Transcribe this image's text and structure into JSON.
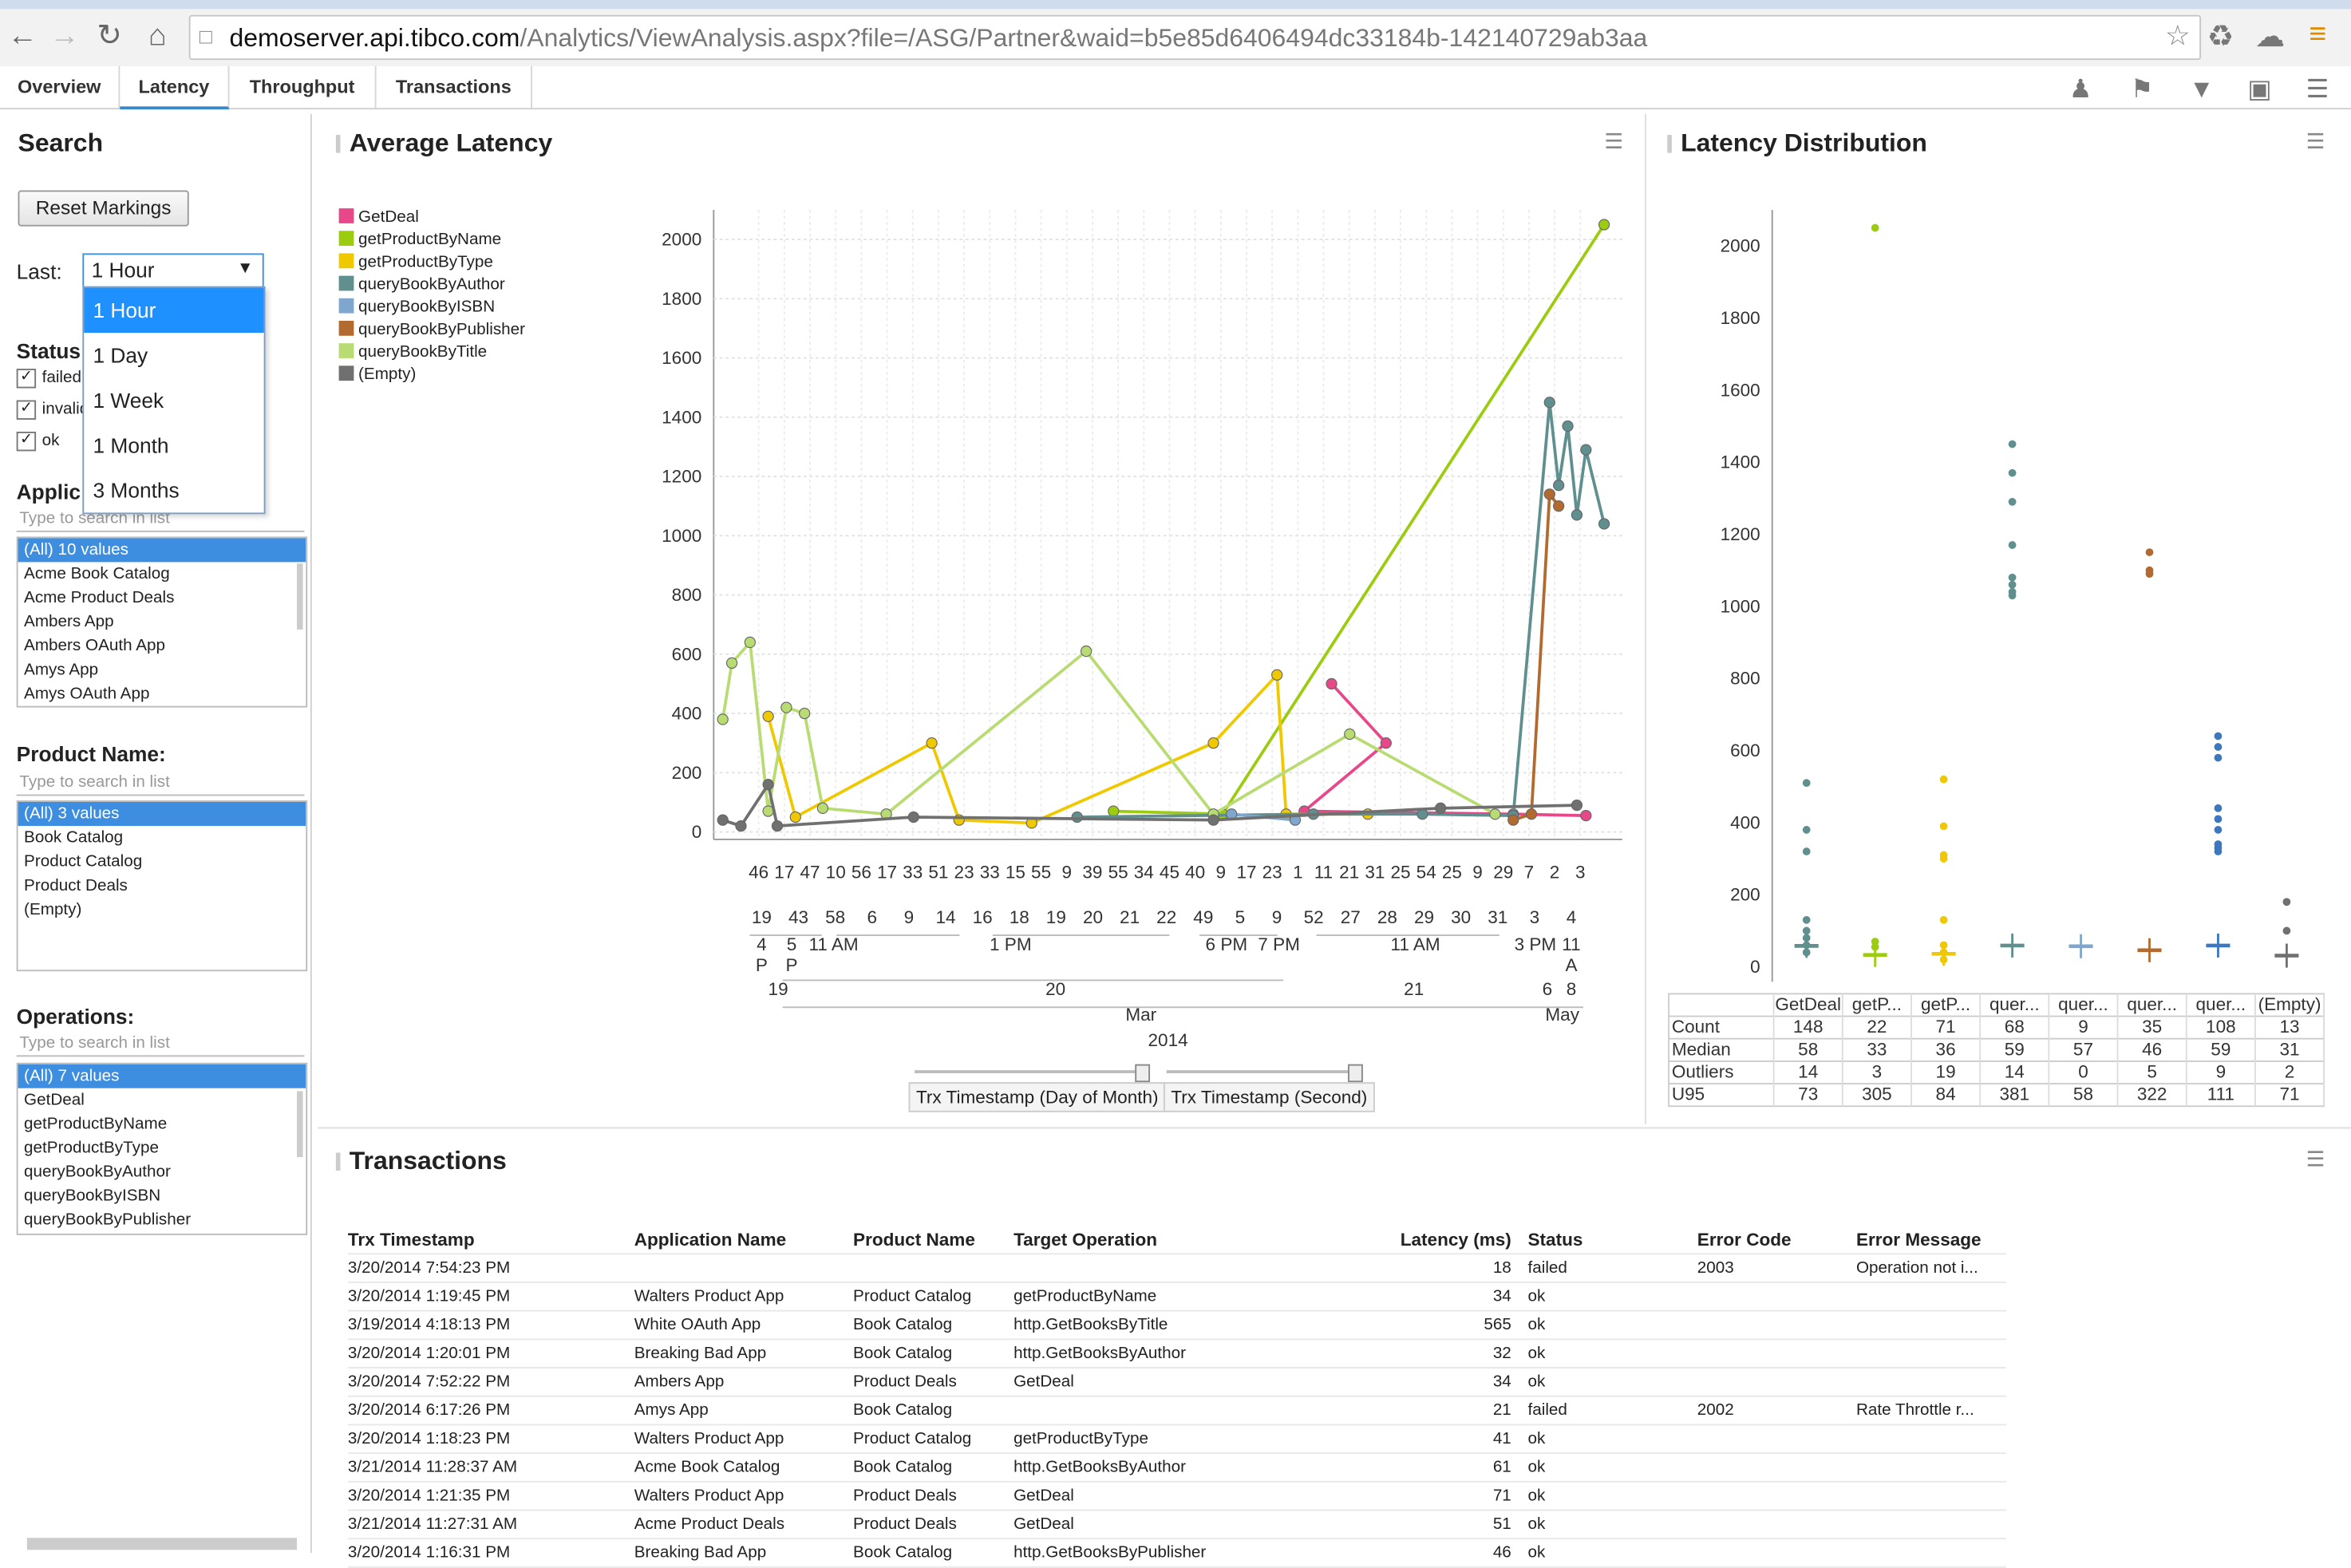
{
  "browser": {
    "url_domain": "demoserver.api.tibco.com",
    "url_path": "/Analytics/ViewAnalysis.aspx?file=/ASG/Partner&waid=b5e85d6406494dc33184b-142140729ab3aa"
  },
  "tabs": [
    {
      "label": "Overview",
      "active": false
    },
    {
      "label": "Latency",
      "active": true
    },
    {
      "label": "Throughput",
      "active": false
    },
    {
      "label": "Transactions",
      "active": false
    }
  ],
  "search": {
    "title": "Search",
    "reset_label": "Reset Markings",
    "last_label": "Last:",
    "last_value": "1 Hour",
    "last_options": [
      "1 Hour",
      "1 Day",
      "1 Week",
      "1 Month",
      "3 Months"
    ],
    "status_label": "Status:",
    "status_items": [
      {
        "label": "failed",
        "checked": true
      },
      {
        "label": "invalid",
        "checked": true
      },
      {
        "label": "ok",
        "checked": true
      }
    ],
    "application_label": "Applic",
    "application_placeholder": "Type to search in list",
    "application_items": [
      "(All) 10 values",
      "Acme Book Catalog",
      "Acme Product Deals",
      "Ambers App",
      "Ambers OAuth App",
      "Amys App",
      "Amys OAuth App"
    ],
    "product_label": "Product Name:",
    "product_placeholder": "Type to search in list",
    "product_items": [
      "(All) 3 values",
      "Book Catalog",
      "Product Catalog",
      "Product Deals",
      "(Empty)"
    ],
    "operations_label": "Operations:",
    "operations_placeholder": "Type to search in list",
    "operations_items": [
      "(All) 7 values",
      "GetDeal",
      "getProductByName",
      "getProductByType",
      "queryBookByAuthor",
      "queryBookByISBN",
      "queryBookByPublisher"
    ]
  },
  "avg_latency": {
    "title": "Average Latency",
    "x_levels": {
      "level1": [
        "46",
        "17",
        "47",
        "10",
        "56",
        "17",
        "33",
        "51",
        "23",
        "33",
        "15",
        "55",
        "9",
        "39",
        "55",
        "34",
        "45",
        "40",
        "9",
        "17",
        "23",
        "1",
        "11",
        "21",
        "31",
        "25",
        "54",
        "25",
        "9",
        "29",
        "7",
        "2",
        "3"
      ],
      "level2": [
        "19",
        "43",
        "58",
        "6",
        "9",
        "14",
        "16",
        "18",
        "19",
        "20",
        "21",
        "22",
        "49",
        "5",
        "9",
        "52",
        "27",
        "28",
        "29",
        "30",
        "31",
        "3",
        "4"
      ],
      "level3": [
        "4",
        "P",
        "5",
        "P",
        "11 AM",
        "1 PM",
        "6 PM",
        "7 PM",
        "11 AM",
        "3 PM",
        "11",
        "A"
      ],
      "level4": [
        "19",
        "20",
        "21",
        "6",
        "8"
      ],
      "level5": [
        "Mar",
        "May"
      ],
      "level6": [
        "2014"
      ]
    },
    "sliders": [
      "Trx Timestamp (Day of Month)",
      "Trx Timestamp (Second)"
    ]
  },
  "chart_data": [
    {
      "type": "line",
      "title": "Average Latency",
      "ylim": [
        0,
        2100
      ],
      "yticks": [
        0,
        200,
        400,
        600,
        800,
        1000,
        1200,
        1400,
        1600,
        1800,
        2000
      ],
      "grid": true,
      "legend_position": "top-left",
      "series": [
        {
          "name": "GetDeal",
          "color": "#e8488a",
          "values": [
            [
              68,
              500
            ],
            [
              74,
              300
            ],
            [
              65,
              70
            ],
            [
              88,
              60
            ],
            [
              96,
              55
            ]
          ]
        },
        {
          "name": "getProductByName",
          "color": "#9ccc10",
          "values": [
            [
              44,
              70
            ],
            [
              56,
              60
            ],
            [
              98,
              2050
            ]
          ]
        },
        {
          "name": "getProductByType",
          "color": "#f0c800",
          "values": [
            [
              6,
              390
            ],
            [
              9,
              50
            ],
            [
              24,
              300
            ],
            [
              27,
              40
            ],
            [
              35,
              30
            ],
            [
              55,
              300
            ],
            [
              62,
              530
            ],
            [
              63,
              60
            ],
            [
              72,
              60
            ]
          ]
        },
        {
          "name": "queryBookByAuthor",
          "color": "#5f8f8f",
          "values": [
            [
              40,
              50
            ],
            [
              66,
              60
            ],
            [
              78,
              60
            ],
            [
              88,
              55
            ],
            [
              92,
              1450
            ],
            [
              93,
              1170
            ],
            [
              94,
              1370
            ],
            [
              95,
              1070
            ],
            [
              96,
              1290
            ],
            [
              98,
              1040
            ]
          ]
        },
        {
          "name": "queryBookByISBN",
          "color": "#7fa6cc",
          "values": [
            [
              57,
              60
            ],
            [
              64,
              40
            ]
          ]
        },
        {
          "name": "queryBookByPublisher",
          "color": "#b36a2e",
          "values": [
            [
              88,
              40
            ],
            [
              90,
              60
            ],
            [
              92,
              1140
            ],
            [
              93,
              1100
            ]
          ]
        },
        {
          "name": "queryBookByTitle",
          "color": "#b8dc72",
          "values": [
            [
              1,
              380
            ],
            [
              2,
              570
            ],
            [
              4,
              640
            ],
            [
              6,
              70
            ],
            [
              8,
              420
            ],
            [
              10,
              400
            ],
            [
              12,
              80
            ],
            [
              19,
              60
            ],
            [
              41,
              610
            ],
            [
              55,
              60
            ],
            [
              70,
              330
            ],
            [
              86,
              60
            ]
          ]
        },
        {
          "name": "(Empty)",
          "color": "#707070",
          "values": [
            [
              1,
              40
            ],
            [
              3,
              20
            ],
            [
              6,
              160
            ],
            [
              7,
              20
            ],
            [
              22,
              50
            ],
            [
              55,
              40
            ],
            [
              80,
              80
            ],
            [
              95,
              90
            ]
          ]
        }
      ]
    },
    {
      "type": "scatter",
      "title": "Latency Distribution",
      "ylim": [
        0,
        2100
      ],
      "yticks": [
        0,
        200,
        400,
        600,
        800,
        1000,
        1200,
        1400,
        1600,
        1800,
        2000
      ],
      "categories": [
        "GetDeal",
        "getP...",
        "getP...",
        "quer...",
        "quer...",
        "quer...",
        "quer...",
        "(Empty)"
      ],
      "series": [
        {
          "name": "GetDeal",
          "color": "#5f8f8f",
          "points": [
            510,
            380,
            320,
            130,
            100,
            80,
            60,
            40
          ],
          "median": 58
        },
        {
          "name": "getProductByName",
          "color": "#9ccc10",
          "points": [
            2050,
            70,
            55
          ],
          "median": 33
        },
        {
          "name": "getProductByType",
          "color": "#f0c800",
          "points": [
            520,
            390,
            310,
            300,
            130,
            60,
            40,
            20
          ],
          "median": 36
        },
        {
          "name": "queryBookByAuthor",
          "color": "#5f8f8f",
          "points": [
            1450,
            1370,
            1290,
            1170,
            1080,
            1060,
            1040,
            1030
          ],
          "median": 59
        },
        {
          "name": "queryBookByISBN",
          "color": "#7fa6cc",
          "points": [],
          "median": 57
        },
        {
          "name": "queryBookByPublisher",
          "color": "#b36a2e",
          "points": [
            1150,
            1100,
            1090
          ],
          "median": 46
        },
        {
          "name": "queryBookByTitle",
          "color": "#3b78c0",
          "points": [
            640,
            610,
            580,
            440,
            410,
            380,
            340,
            330,
            320
          ],
          "median": 59
        },
        {
          "name": "(Empty)",
          "color": "#707070",
          "points": [
            180,
            100
          ],
          "median": 31
        }
      ],
      "stats": {
        "labels": [
          "Count",
          "Median",
          "Outliers",
          "U95"
        ],
        "rows": [
          [
            "148",
            "22",
            "71",
            "68",
            "9",
            "35",
            "108",
            "13"
          ],
          [
            "58",
            "33",
            "36",
            "59",
            "57",
            "46",
            "59",
            "31"
          ],
          [
            "14",
            "3",
            "19",
            "14",
            "0",
            "5",
            "9",
            "2"
          ],
          [
            "73",
            "305",
            "84",
            "381",
            "58",
            "322",
            "111",
            "71"
          ]
        ]
      }
    }
  ],
  "dist": {
    "title": "Latency Distribution"
  },
  "transactions": {
    "title": "Transactions",
    "headers": [
      "Trx Timestamp",
      "Application Name",
      "Product Name",
      "Target Operation",
      "Latency (ms)",
      "Status",
      "Error Code",
      "Error Message"
    ],
    "rows": [
      [
        "3/20/2014 7:54:23 PM",
        "",
        "",
        "",
        "18",
        "failed",
        "2003",
        "Operation not i..."
      ],
      [
        "3/20/2014 1:19:45 PM",
        "Walters Product App",
        "Product Catalog",
        "getProductByName",
        "34",
        "ok",
        "",
        ""
      ],
      [
        "3/19/2014 4:18:13 PM",
        "White OAuth App",
        "Book Catalog",
        "http.GetBooksByTitle",
        "565",
        "ok",
        "",
        ""
      ],
      [
        "3/20/2014 1:20:01 PM",
        "Breaking Bad App",
        "Book Catalog",
        "http.GetBooksByAuthor",
        "32",
        "ok",
        "",
        ""
      ],
      [
        "3/20/2014 7:52:22 PM",
        "Ambers App",
        "Product Deals",
        "GetDeal",
        "34",
        "ok",
        "",
        ""
      ],
      [
        "3/20/2014 6:17:26 PM",
        "Amys App",
        "Book Catalog",
        "",
        "21",
        "failed",
        "2002",
        "Rate Throttle r..."
      ],
      [
        "3/20/2014 1:18:23 PM",
        "Walters Product App",
        "Product Catalog",
        "getProductByType",
        "41",
        "ok",
        "",
        ""
      ],
      [
        "3/21/2014 11:28:37 AM",
        "Acme Book Catalog",
        "Book Catalog",
        "http.GetBooksByAuthor",
        "61",
        "ok",
        "",
        ""
      ],
      [
        "3/20/2014 1:21:35 PM",
        "Walters Product App",
        "Product Deals",
        "GetDeal",
        "71",
        "ok",
        "",
        ""
      ],
      [
        "3/21/2014 11:27:31 AM",
        "Acme Product Deals",
        "Product Deals",
        "GetDeal",
        "51",
        "ok",
        "",
        ""
      ],
      [
        "3/20/2014 1:16:31 PM",
        "Breaking Bad App",
        "Book Catalog",
        "http.GetBooksByPublisher",
        "46",
        "ok",
        "",
        ""
      ]
    ]
  }
}
